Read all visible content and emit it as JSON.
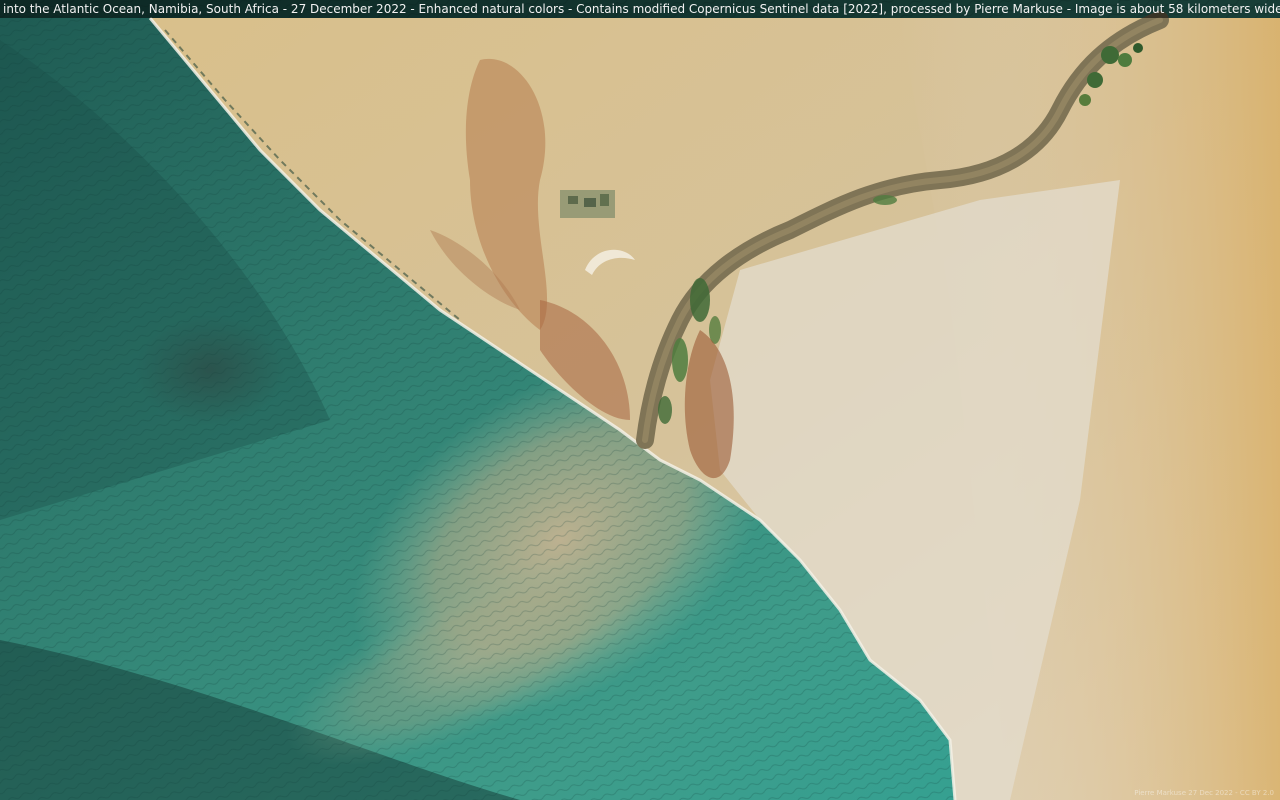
{
  "image": {
    "subject": "Satellite view of a river mouth on the Atlantic coast",
    "caption": "into the Atlantic Ocean, Namibia, South Africa - 27 December 2022 - Enhanced natural colors - Contains modified Copernicus Sentinel data [2022], processed by Pierre Markuse - Image is about 58 kilometers wide",
    "watermark": "Pierre Markuse 27 Dec 2022 - CC BY 2.0"
  },
  "colors": {
    "ocean_deep": "#1e5a52",
    "ocean_shallow": "#3e9c8a",
    "ocean_turquoise": "#2fa396",
    "sediment_plume": "#c4b391",
    "desert_north": "#d9c08b",
    "desert_south": "#e1d3b9",
    "desert_east": "#d9b068",
    "river": "#7f7456",
    "vegetation": "#3f6a36"
  }
}
